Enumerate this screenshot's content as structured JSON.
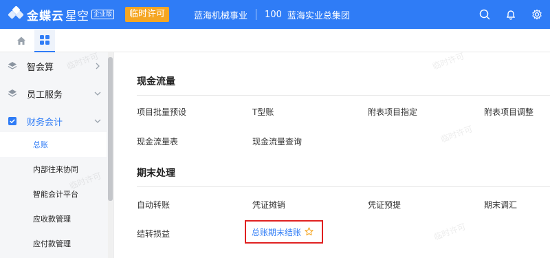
{
  "header": {
    "brand_name": "金蝶云",
    "brand_product": "星空",
    "edition": "企业版",
    "license_badge": "临时许可",
    "org_name": "蓝海机械事业",
    "org_code": "100",
    "group_name": "蓝海实业总集团",
    "icons": [
      "search-icon",
      "bell-icon",
      "settings-icon"
    ]
  },
  "tabs": {
    "icons": [
      "home-icon",
      "apps-grid-icon"
    ]
  },
  "sidebar": {
    "groups": [
      {
        "label": "智会算",
        "icon": "layers-icon",
        "state": "collapsed"
      },
      {
        "label": "员工服务",
        "icon": "layers-icon",
        "state": "collapsed"
      },
      {
        "label": "财务会计",
        "icon": "checkbox-icon",
        "state": "expanded"
      }
    ],
    "sub_items": [
      {
        "label": "总账",
        "selected": true
      },
      {
        "label": "内部往来协同",
        "selected": false
      },
      {
        "label": "智能会计平台",
        "selected": false
      },
      {
        "label": "应收款管理",
        "selected": false
      },
      {
        "label": "应付款管理",
        "selected": false
      }
    ]
  },
  "main": {
    "sections": [
      {
        "title": "现金流量",
        "rows": [
          [
            "项目批量预设",
            "T型账",
            "附表项目指定",
            "附表项目调整"
          ],
          [
            "现金流量表",
            "现金流量查询"
          ]
        ]
      },
      {
        "title": "期末处理",
        "rows": [
          [
            "自动转账",
            "凭证摊销",
            "凭证预提",
            "期末调汇"
          ],
          [
            "结转损益",
            "总账期末结账"
          ]
        ]
      }
    ],
    "highlighted_item": "总账期末结账",
    "watermark_text": "临时许可"
  },
  "colors": {
    "primary": "#2f7cf6",
    "license": "#f5a623",
    "highlight_border": "#e02020",
    "star": "#f5a623"
  }
}
